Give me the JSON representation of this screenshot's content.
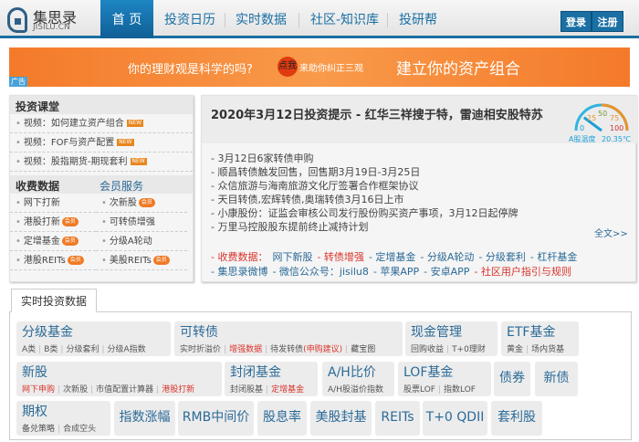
{
  "header": {
    "logo_cn": "集思录",
    "logo_en": "JISILU.CN",
    "nav": [
      "首 页",
      "投资日历",
      "实时数据",
      "社区-知识库",
      "投研帮"
    ],
    "login": "登录",
    "register": "注册"
  },
  "banner": {
    "text1": "你的理财观是科学的吗?",
    "dot": "点我",
    "text2": "来助你纠正三观",
    "text3": "建立你的资产组合",
    "ad": "广告"
  },
  "left": {
    "course_title": "投资课堂",
    "courses": [
      "视频：如何建立资产组合",
      "视频：FOF与资产配置",
      "视频：股指期货-期现套利"
    ],
    "new_badge": "NEW",
    "paid_title": "收费数据",
    "member_title": "会员服务",
    "vip_badge": "会员",
    "paid_items": [
      [
        "网下打新",
        false
      ],
      [
        "次新股",
        true
      ],
      [
        "港股打新",
        true
      ],
      [
        "可转债增强",
        false
      ],
      [
        "定增基金",
        true
      ],
      [
        "分级A轮动",
        false
      ],
      [
        "港股REITs",
        true
      ],
      [
        "美股REITs",
        true
      ]
    ]
  },
  "right": {
    "title": "2020年3月12日投资提示 - 红华三祥搜于特，雷迪相安股特苏",
    "gauge": {
      "ticks": [
        "0",
        "25",
        "50",
        "75",
        "100"
      ],
      "label": "A股温度",
      "value": "20.35℃",
      "level": 20.35
    },
    "news": [
      "- 3月12日6家转债申购",
      "- 顺昌转债触发回售，回售期3月19日-3月25日",
      "- 众信旅游与海南旅游文化厅签署合作框架协议",
      "- 天目转债,宏辉转债,奥瑞转债3月16日上市",
      "- 小康股份：证监会审核公司发行股份购买资产事项，3月12日起停牌",
      "- 万里马控股股东提前终止减持计划"
    ],
    "more": "全文>>",
    "links1": [
      [
        "- 收费数据：",
        "red"
      ],
      [
        "网下新股",
        "blue"
      ],
      [
        "- 转债增强",
        "red"
      ],
      [
        "- 定增基金",
        "blue"
      ],
      [
        "- 分级A轮动",
        "blue"
      ],
      [
        "- 分级套利",
        "blue"
      ],
      [
        "- 杠杆基金",
        "blue"
      ]
    ],
    "links2": [
      [
        "- 集思录微博",
        "blue"
      ],
      [
        "- 微信公众号：jisilu8",
        "blue"
      ],
      [
        "- 苹果APP",
        "blue"
      ],
      [
        "- 安卓APP",
        "blue"
      ],
      [
        "- 社区用户指引与规则",
        "red"
      ]
    ]
  },
  "data": {
    "tab": "实时投资数据",
    "cells": [
      {
        "h": "分级基金",
        "s": [
          [
            "A类",
            0
          ],
          [
            "B类",
            0
          ],
          [
            "分级套利",
            0
          ],
          [
            "分级A指数",
            0
          ]
        ]
      },
      {
        "h": "可转债",
        "s": [
          [
            "实时折溢价",
            0
          ],
          [
            "增强数据",
            1
          ],
          [
            "待发转债(申购建议)",
            2
          ],
          [
            "藏宝图",
            0
          ]
        ]
      },
      {
        "h": "现金管理",
        "s": [
          [
            "回购收益",
            0
          ],
          [
            "T+0理财",
            0
          ]
        ]
      },
      {
        "h": "ETF基金",
        "s": [
          [
            "黄金",
            0
          ],
          [
            "场内货基",
            0
          ]
        ]
      },
      {
        "h": "新股",
        "s": [
          [
            "网下申购",
            1
          ],
          [
            "次新股",
            0
          ],
          [
            "市值配置计算器",
            0
          ],
          [
            "港股打新",
            1
          ]
        ]
      },
      {
        "h": "封闭基金",
        "s": [
          [
            "封闭股基",
            0
          ],
          [
            "定增基金",
            1
          ]
        ]
      },
      {
        "h": "A/H比价",
        "s": [
          [
            "A/H股溢价指数",
            0
          ]
        ]
      },
      {
        "h": "LOF基金",
        "s": [
          [
            "股票LOF",
            0
          ],
          [
            "指数LOF",
            0
          ]
        ]
      },
      {
        "h": "债券"
      },
      {
        "h": "新债"
      },
      {
        "h": "期权",
        "s": [
          [
            "备兑策略",
            0
          ],
          [
            "合成空头",
            0
          ]
        ]
      },
      {
        "h": "指数涨幅"
      },
      {
        "h": "RMB中间价"
      },
      {
        "h": "股息率"
      },
      {
        "h": "美股封基"
      },
      {
        "h": "REITs",
        "red": true
      },
      {
        "h": "T+0 QDII"
      },
      {
        "h": "套利股"
      }
    ]
  },
  "colors": {
    "brand": "#1a6fa3",
    "red": "#d9342b",
    "banner": "#f47a2a"
  }
}
